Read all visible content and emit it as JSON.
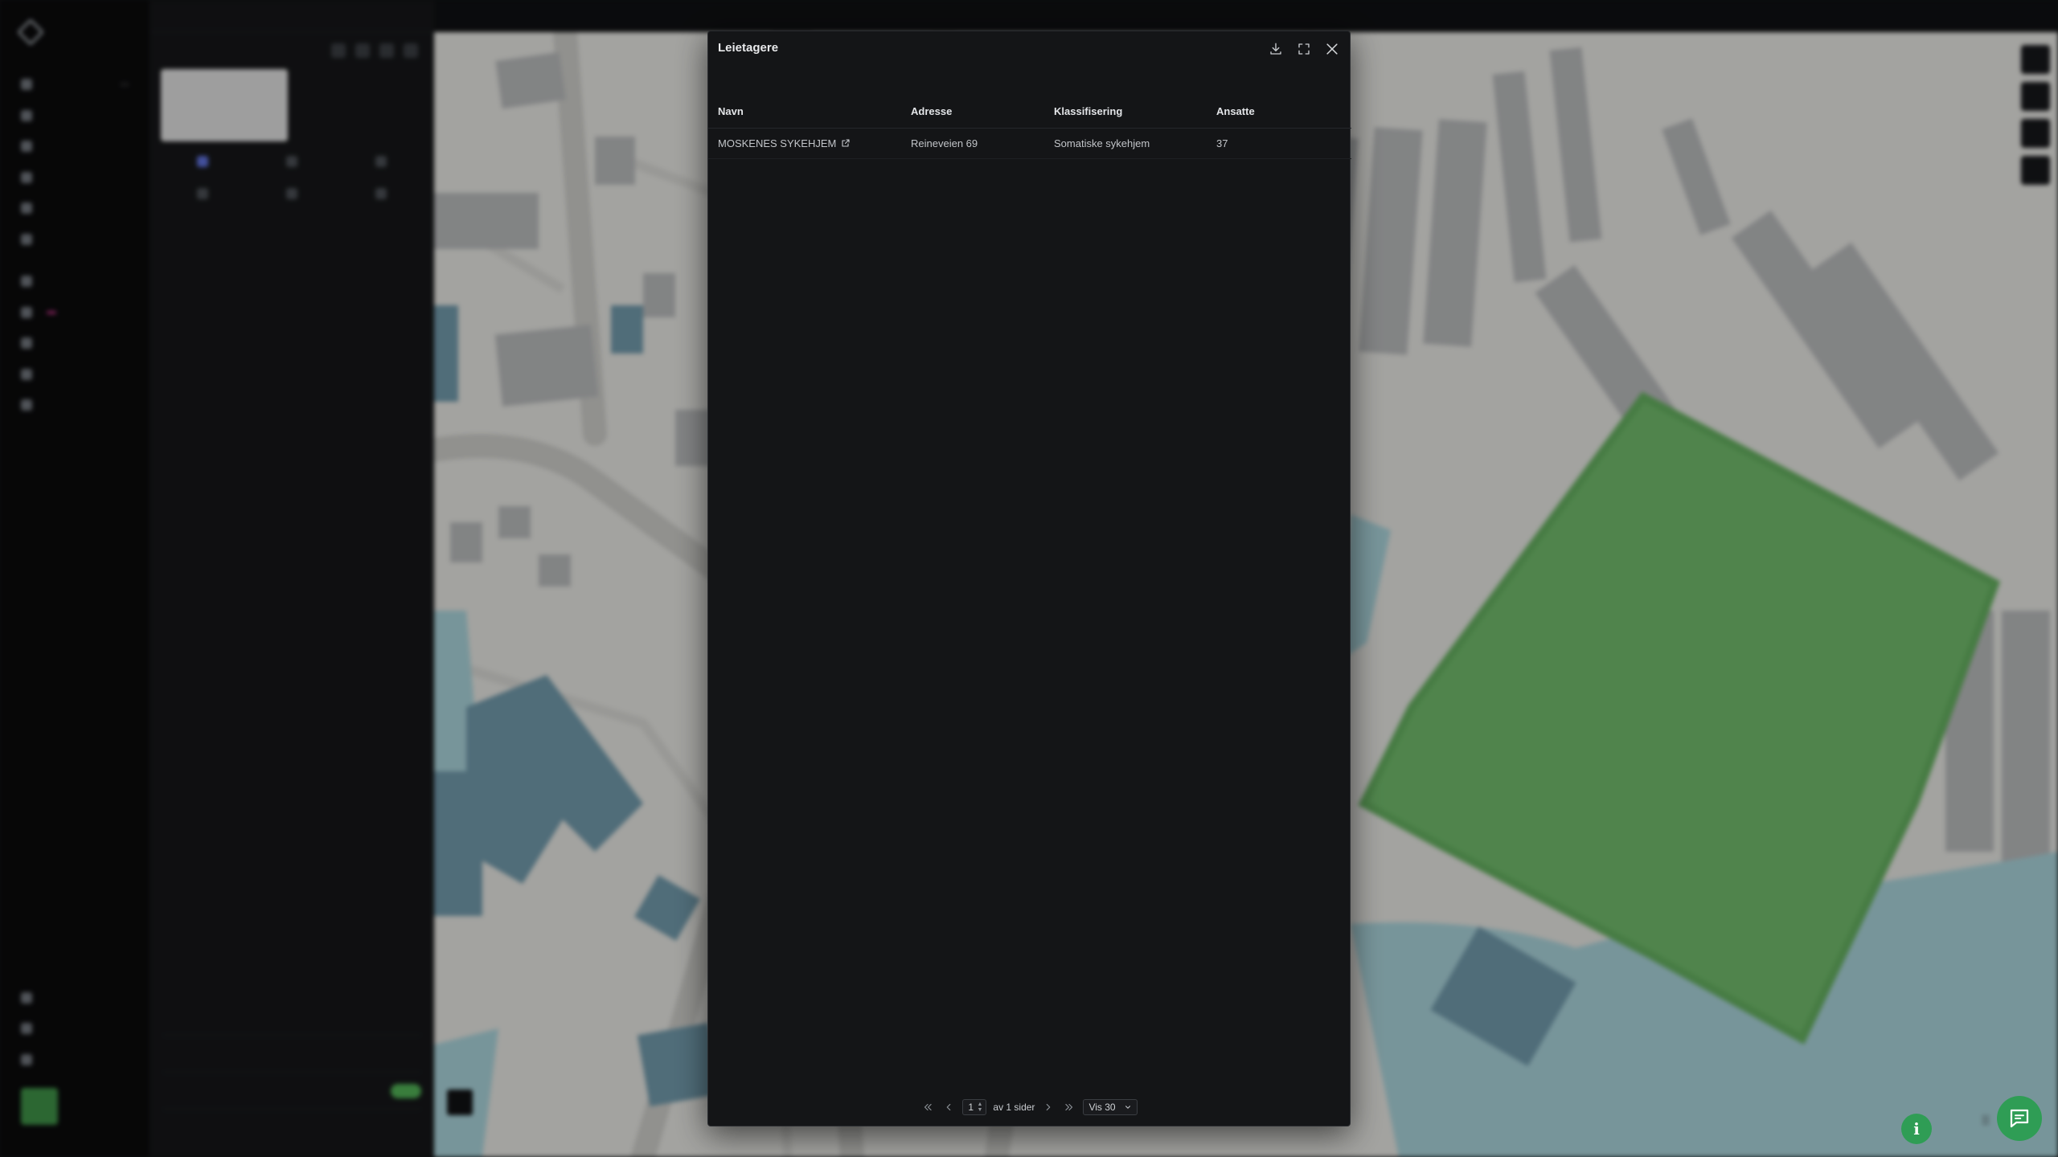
{
  "dialog": {
    "title": "Leietagere",
    "columns": [
      "Navn",
      "Adresse",
      "Klassifisering",
      "Ansatte"
    ],
    "rows": [
      {
        "name": "MOSKENES SYKEHJEM",
        "address": "Reineveien 69",
        "classification": "Somatiske sykehjem",
        "employees": "37"
      }
    ],
    "pagination": {
      "current_page": "1",
      "pages_text": "av 1 sider",
      "page_size": "Vis 30"
    },
    "icons": {
      "download": "download-icon",
      "fullscreen": "expand-icon",
      "close": "close-icon",
      "external": "external-link-icon"
    }
  },
  "colors": {
    "modal_bg": "#141517",
    "accent_green": "#2f9d55",
    "map_polygon": "#6fb86a",
    "water": "#a6cfd6"
  }
}
